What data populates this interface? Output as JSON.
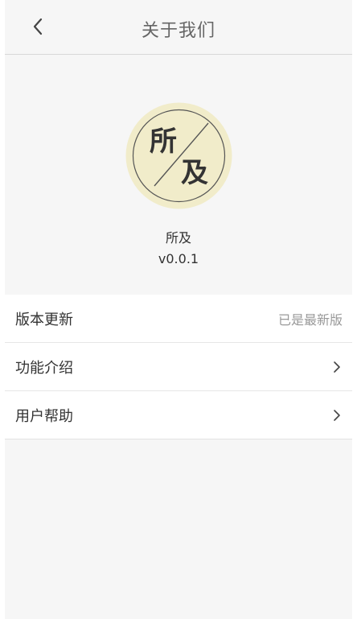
{
  "header": {
    "back_icon": "chevron-left-icon",
    "title": "关于我们"
  },
  "app": {
    "logo_text_top": "所",
    "logo_text_bottom": "及",
    "name": "所及",
    "version": "v0.0.1",
    "logo_fill": "#f1ecca"
  },
  "menu": {
    "items": [
      {
        "label": "版本更新",
        "value": "已是最新版"
      },
      {
        "label": "功能介绍",
        "icon": "chevron-right-icon"
      },
      {
        "label": "用户帮助",
        "icon": "chevron-right-icon"
      }
    ]
  }
}
